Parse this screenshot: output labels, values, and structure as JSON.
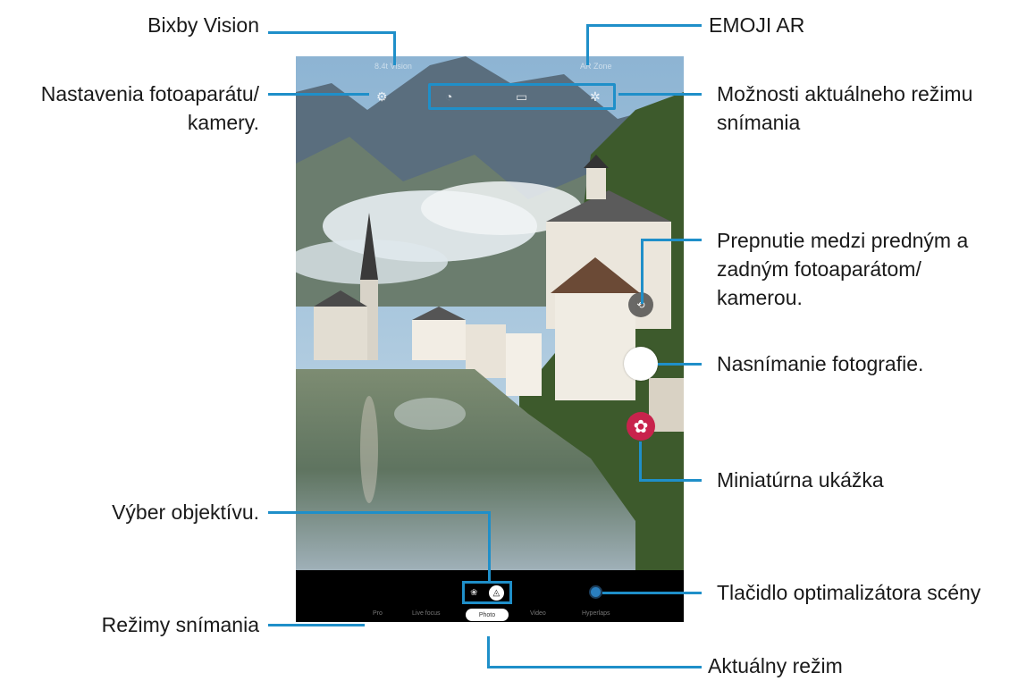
{
  "callouts": {
    "bixby_vision": "Bixby Vision",
    "emoji_ar": "EMOJI AR",
    "camera_settings_line1": "Nastavenia fotoaparátu/",
    "camera_settings_line2": "kamery.",
    "mode_options_line1": "Možnosti aktuálneho režimu",
    "mode_options_line2": "snímania",
    "switch_camera_line1": "Prepnutie medzi predným a",
    "switch_camera_line2": "zadným fotoaparátom/",
    "switch_camera_line3": "kamerou.",
    "take_picture": "Nasnímanie fotografie.",
    "preview_thumbnail": "Miniatúrna ukážka",
    "lens_selection": "Výber objektívu.",
    "scene_optimizer": "Tlačidlo optimalizátora scény",
    "shooting_modes": "Režimy snímania",
    "current_mode": "Aktuálny režim"
  },
  "screen": {
    "status_left": "8.4t  Vision",
    "status_right": "AR Zone",
    "modes": [
      "Pro",
      "Live focus",
      "Photo",
      "Video",
      "Hyperlaps"
    ],
    "current_mode": "Photo"
  },
  "icons": {
    "settings": "gear-icon",
    "timer": "timer-icon",
    "ratio": "aspect-ratio-icon",
    "filter": "sparkle-filter-icon",
    "switch_camera": "switch-camera-icon",
    "shutter": "shutter-button",
    "thumbnail": "flower-thumbnail-icon",
    "lens_wide": "wide-lens-icon",
    "lens_normal": "normal-lens-icon",
    "scene_optimizer": "scene-optimizer-icon"
  },
  "colors": {
    "accent": "#1f8fc9",
    "thumbnail": "#c8234c",
    "bar": "#000000"
  }
}
